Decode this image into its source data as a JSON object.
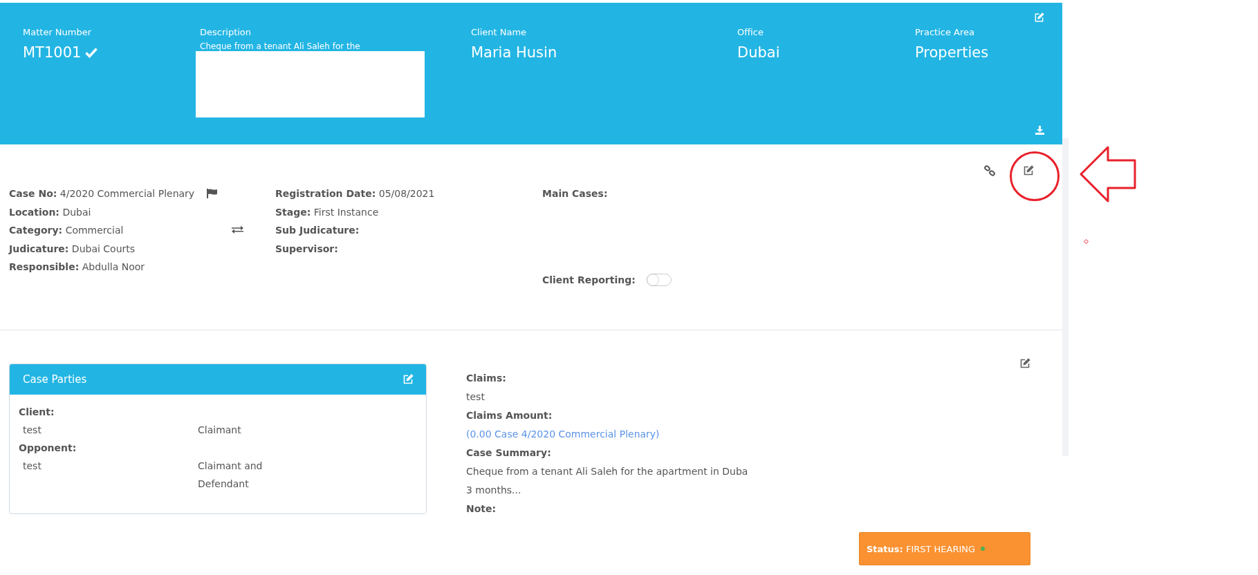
{
  "header": {
    "fields": [
      {
        "label": "Matter Number",
        "value": "MT1001",
        "verified": true,
        "redacted": false
      },
      {
        "label": "Description",
        "value": "Cheque from a tenant Ali Saleh for the",
        "verified": false,
        "redacted": true
      },
      {
        "label": "Client Name",
        "value": "Maria Husin",
        "verified": false,
        "redacted": false
      },
      {
        "label": "Office",
        "value": "Dubai",
        "verified": false,
        "redacted": false
      },
      {
        "label": "Practice Area",
        "value": "Properties",
        "verified": false,
        "redacted": false
      }
    ]
  },
  "details": {
    "left": [
      {
        "label": "Case No:",
        "value": "4/2020 Commercial Plenary",
        "flagged": true
      },
      {
        "label": "Location:",
        "value": "Dubai",
        "flagged": false
      },
      {
        "label": "Category:",
        "value": "Commercial",
        "flagged": false
      },
      {
        "label": "Judicature:",
        "value": "Dubai Courts",
        "flagged": false
      },
      {
        "label": "Responsible:",
        "value": "Abdulla Noor",
        "flagged": false
      }
    ],
    "middle": [
      {
        "label": "Registration Date:",
        "value": "05/08/2021"
      },
      {
        "label": "Stage:",
        "value": "First Instance"
      },
      {
        "label": "Sub Judicature:"
      },
      {
        "label": "Supervisor:"
      }
    ],
    "main_cases": {
      "label": "Main Cases:"
    },
    "client_reporting": {
      "label": "Client Reporting:",
      "on": false
    }
  },
  "case_parties": {
    "title": "Case Parties",
    "groups": [
      {
        "label": "Client:",
        "rows": [
          {
            "name": "test",
            "role": "Claimant"
          }
        ]
      },
      {
        "label": "Opponent:",
        "rows": [
          {
            "name": "test",
            "role": "Claimant and Defendant"
          }
        ]
      }
    ]
  },
  "claims": [
    {
      "label": "Claims:",
      "kind": "text",
      "lines": [
        "test"
      ]
    },
    {
      "label": "Claims Amount:",
      "kind": "link",
      "lines": [
        "(0.00 Case 4/2020 Commercial Plenary)"
      ]
    },
    {
      "label": "Case Summary:",
      "kind": "text",
      "lines": [
        "Cheque from a tenant Ali Saleh for the apartment in Duba",
        "3 months..."
      ]
    },
    {
      "label": "Note:"
    }
  ],
  "status": {
    "label": "Status:",
    "value": "FIRST HEARING"
  }
}
